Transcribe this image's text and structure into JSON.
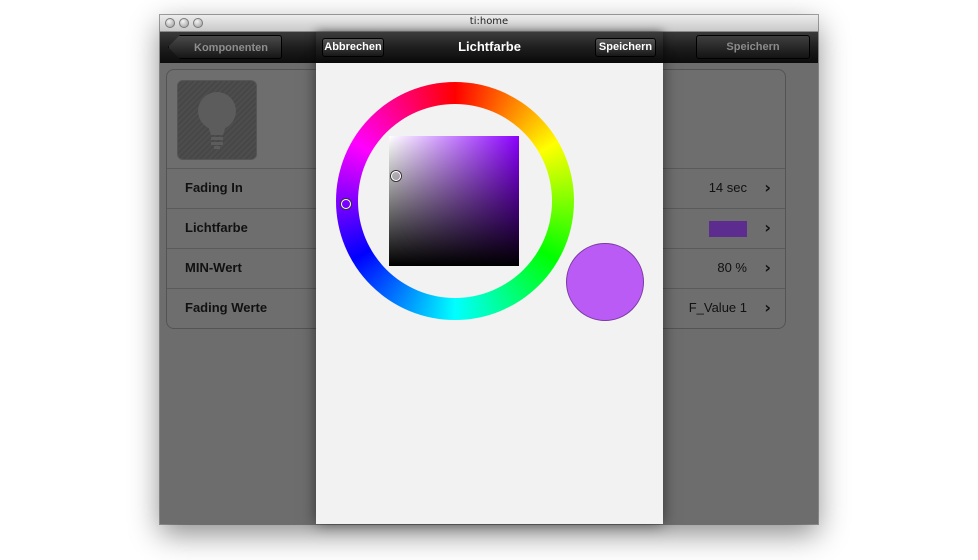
{
  "window": {
    "title": "ti:home"
  },
  "navbar": {
    "back_label": "Komponenten",
    "save_label": "Speichern"
  },
  "settings": {
    "rows": [
      {
        "label": "Fading In",
        "value": "14 sec"
      },
      {
        "label": "Lichtfarbe",
        "value": "",
        "swatch_color": "#5c2d8e"
      },
      {
        "label": "MIN-Wert",
        "value": "80 %"
      },
      {
        "label": "Fading Werte",
        "value": "F_Value 1"
      }
    ]
  },
  "modal": {
    "title": "Lichtfarbe",
    "cancel_label": "Abbrechen",
    "save_label": "Speichern",
    "selected_color": "#bb5bf6"
  },
  "icons": [
    "lightbulb-icon",
    "chevron-right-icon"
  ]
}
